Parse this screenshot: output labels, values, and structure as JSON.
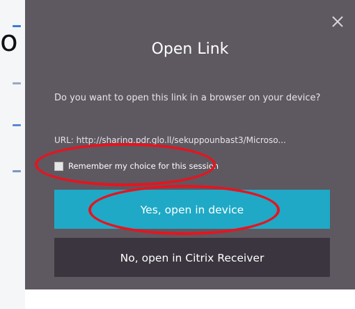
{
  "background": {
    "partial_text": "o"
  },
  "dialog": {
    "title": "Open Link",
    "question": "Do you want to open this link in a browser on your device?",
    "url_line": "URL: http://sharing.pdr.glo.ll/sekuppounbast3/Microso...",
    "remember_label": "Remember my choice for this session",
    "remember_checked": false,
    "yes_button_label": "Yes, open in device",
    "no_button_label": "No, open in Citrix Receiver",
    "colors": {
      "dialog_bg": "#5e5860",
      "yes_button": "#1fa9c6",
      "no_button": "#3b3540",
      "annotation": "#e6141f"
    }
  }
}
